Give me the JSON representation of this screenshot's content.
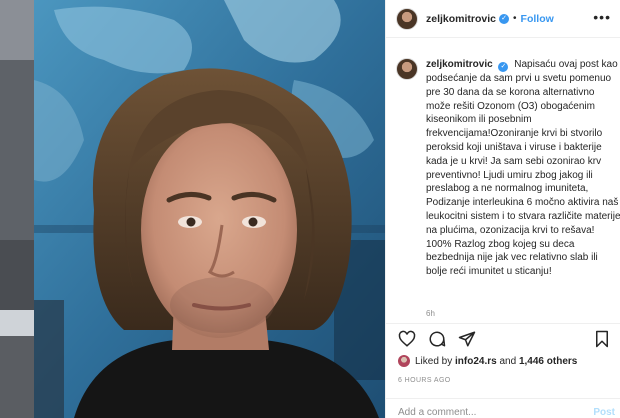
{
  "post": {
    "username": "zeljkomitrovic",
    "verified_glyph": "✓",
    "separator": "•",
    "follow_label": "Follow",
    "more_glyph": "•••",
    "caption_text": "Napisaću ovaj post kao podsećanje da sam prvi u svetu pomenuo pre 30 dana da se korona alternativno može rešiti Ozonom (O3) obogaćenim kiseonikom ili posebnim frekvencijama!Ozoniranje krvi bi stvorilo peroksid koji uništava i viruse i bakterije kada je u krvi! Ja sam sebi ozonirao krv preventivno! Ljudi umiru zbog jakog ili preslabog a ne normalnog imuniteta, Podizanje interleukina 6 močno aktivira naš leukocitni sistem i to stvara različite materije na plućima, ozonizacija krvi to rešava! 100% Razlog zbog kojeg su deca bezbednija nije jak vec relativno slab ili bolje reći imunitet u sticanju!",
    "caption_age": "6h"
  },
  "likes": {
    "prefix": "Liked by",
    "user": "info24.rs",
    "middle": "and",
    "others": "1,446 others"
  },
  "timestamp": "6 HOURS AGO",
  "comment": {
    "placeholder": "Add a comment...",
    "post_label": "Post"
  },
  "icons": {
    "like": "heart-icon",
    "comment": "comment-icon",
    "share": "share-icon",
    "save": "bookmark-icon",
    "more": "more-options-icon"
  },
  "colors": {
    "accent": "#3897f0",
    "text": "#262626",
    "muted": "#8e8e8e",
    "border": "#efefef"
  }
}
